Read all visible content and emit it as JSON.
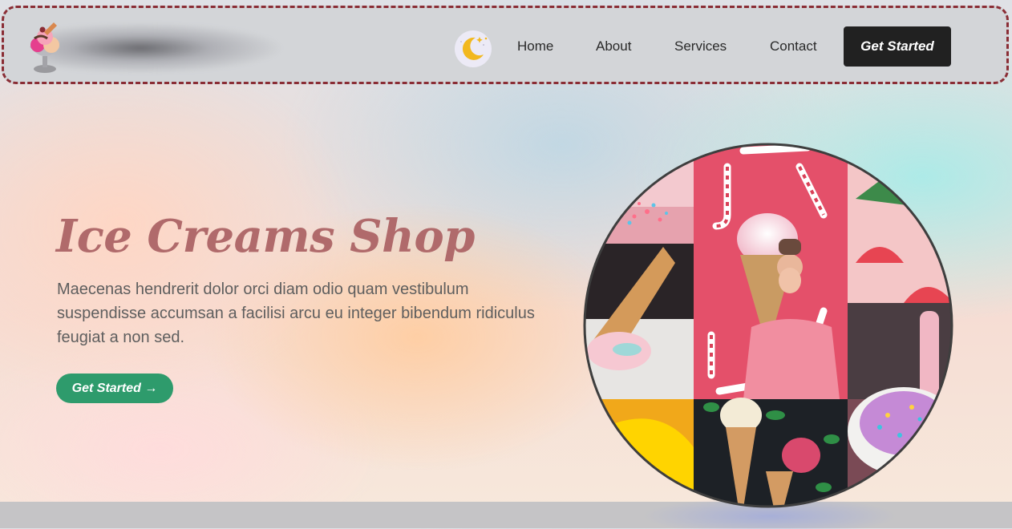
{
  "nav": {
    "logo_icon": "ice-cream-sundae-icon",
    "theme_icon": "moon-stars-icon",
    "links": [
      "Home",
      "About",
      "Services",
      "Contact"
    ],
    "cta_label": "Get Started"
  },
  "hero": {
    "title": "Ice Creams Shop",
    "description": "Maecenas hendrerit dolor orci diam odio quam vestibulum suspendisse accumsan a facilisi arcu eu integer bibendum ridiculus feugiat a non sed.",
    "cta_label": "Get Started →",
    "image_description": ""
  },
  "colors": {
    "nav_border": "#8a2d35",
    "nav_bg": "#d3d5d8",
    "nav_cta_bg": "#212121",
    "title": "#b06a6b",
    "hero_cta_bg": "#2e9b6c",
    "bottom_band": "#c5c4c6"
  }
}
